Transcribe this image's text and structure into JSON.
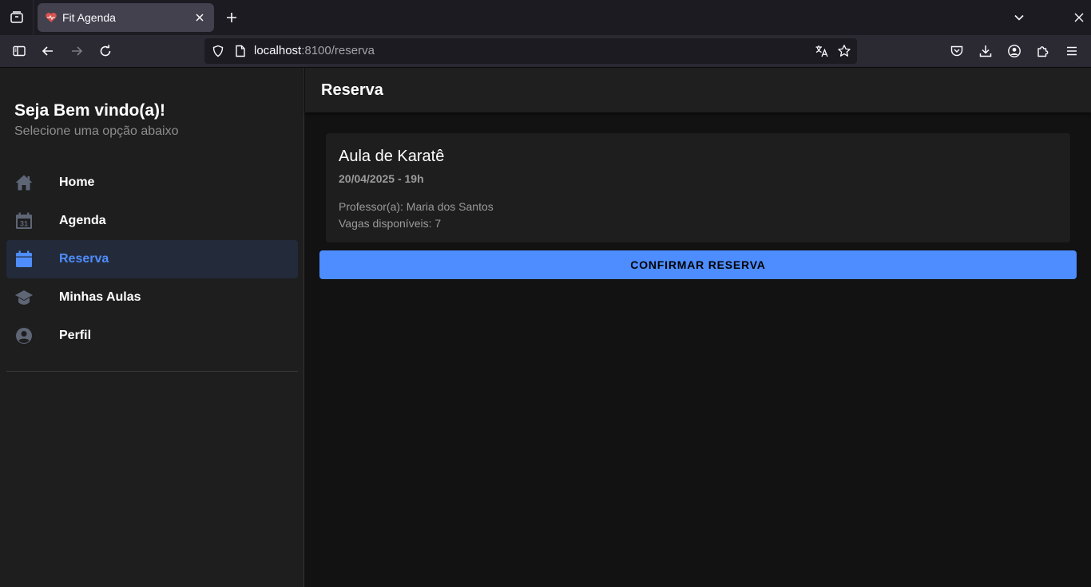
{
  "browser": {
    "tab": {
      "title": "Fit Agenda"
    },
    "url": {
      "host": "localhost",
      "rest": ":8100/reserva"
    }
  },
  "sidebar": {
    "title": "Seja Bem vindo(a)!",
    "subtitle": "Selecione uma opção abaixo",
    "items": [
      {
        "label": "Home",
        "icon": "home-icon",
        "active": false
      },
      {
        "label": "Agenda",
        "icon": "calendar-icon",
        "active": false
      },
      {
        "label": "Reserva",
        "icon": "calendar-reserve-icon",
        "active": true
      },
      {
        "label": "Minhas Aulas",
        "icon": "school-icon",
        "active": false
      },
      {
        "label": "Perfil",
        "icon": "person-circle-icon",
        "active": false
      }
    ],
    "calendar_icon_day": "31"
  },
  "main": {
    "header_title": "Reserva",
    "card": {
      "title": "Aula de Karatê",
      "subtitle": "20/04/2025 - 19h",
      "teacher": "Professor(a): Maria dos Santos",
      "vacancies": "Vagas disponíveis: 7"
    },
    "confirm_label": "CONFIRMAR RESERVA"
  },
  "colors": {
    "accent": "#4d8dff",
    "active_text": "#4f8dfd",
    "sidebar_bg": "#1e1e1e",
    "main_bg": "#121212"
  }
}
